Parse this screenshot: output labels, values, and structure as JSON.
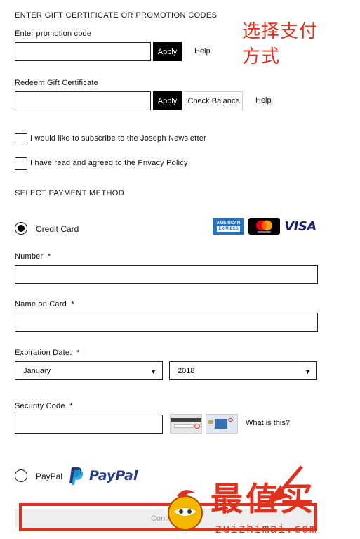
{
  "promo": {
    "section_title": "ENTER GIFT CERTIFICATE OR PROMOTION CODES",
    "promo_label": "Enter promotion code",
    "promo_value": "",
    "apply_label": "Apply",
    "help_label": "Help",
    "gift_label": "Redeem Gift Certificate",
    "gift_value": "",
    "check_balance_label": "Check Balance"
  },
  "checkboxes": {
    "newsletter": "I would like to subscribe to the Joseph Newsletter",
    "privacy": "I have read and agreed to the Privacy Policy"
  },
  "payment": {
    "section_title": "SELECT PAYMENT METHOD",
    "credit_card_label": "Credit Card",
    "number_label": "Number",
    "name_label": "Name on Card",
    "expiration_label": "Expiration Date:",
    "required_mark": "*",
    "month_value": "January",
    "year_value": "2018",
    "security_label": "Security Code",
    "what_is_this": "What is this?",
    "paypal_label": "PayPal",
    "paypal_logo_text": "PayPal",
    "continue_label": "Continue"
  },
  "logos": {
    "amex_line1": "AMERICAN",
    "amex_line2": "EXPRESS",
    "visa": "VISA"
  },
  "annotation": {
    "line1": "选择支付",
    "line2": "方式"
  },
  "watermark": {
    "chinese": "最值买",
    "domain": "zuizhimai.com"
  },
  "colors": {
    "annotation_red": "#e0311f",
    "paypal_dark": "#253b80",
    "paypal_light": "#179bd7",
    "visa_blue": "#1a1f71",
    "amex_blue": "#2671b9"
  }
}
